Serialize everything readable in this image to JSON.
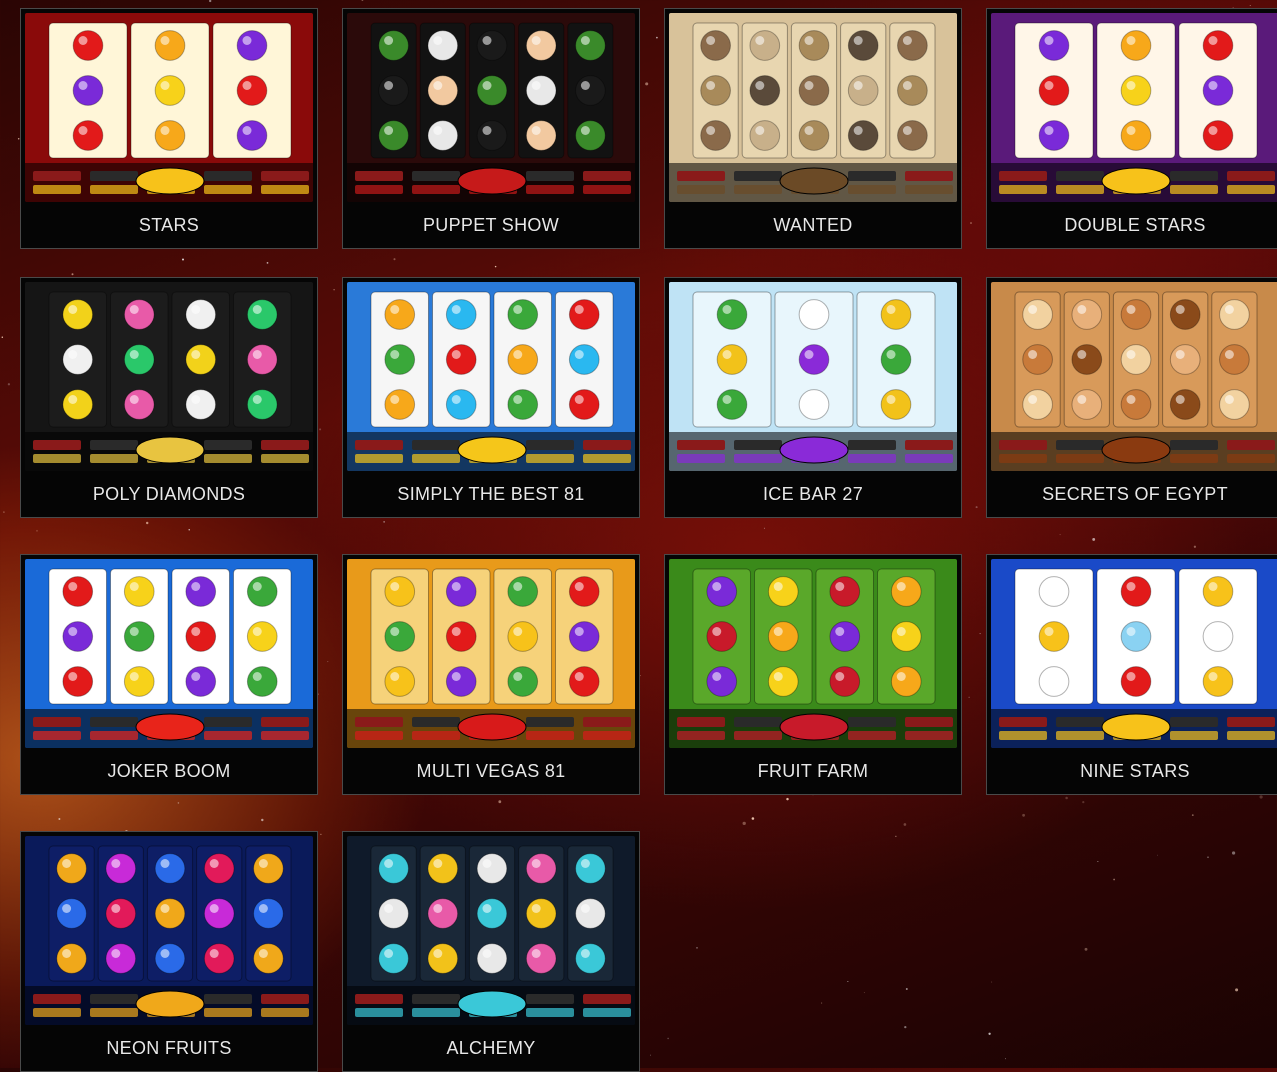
{
  "games": [
    {
      "title": "STARS",
      "theme": "fruit-classic",
      "bg": "#8a0a0a",
      "accent": "#f7c21a"
    },
    {
      "title": "PUPPET SHOW",
      "theme": "puppets",
      "bg": "#2b0a0a",
      "accent": "#c61a1a"
    },
    {
      "title": "WANTED",
      "theme": "western",
      "bg": "#d8c29a",
      "accent": "#6b4a26"
    },
    {
      "title": "DOUBLE STARS",
      "theme": "fruit-purple",
      "bg": "#5a1a7a",
      "accent": "#f7c21a"
    },
    {
      "title": "POLY DIAMONDS",
      "theme": "diamonds",
      "bg": "#151515",
      "accent": "#e8c440"
    },
    {
      "title": "SIMPLY THE BEST 81",
      "theme": "fruit-blue",
      "bg": "#2a7ad8",
      "accent": "#f5c61a"
    },
    {
      "title": "ICE BAR 27",
      "theme": "ice",
      "bg": "#bfe3f5",
      "accent": "#8a2ad8"
    },
    {
      "title": "SECRETS OF EGYPT",
      "theme": "egypt",
      "bg": "#c88a4a",
      "accent": "#8a3a10"
    },
    {
      "title": "JOKER BOOM",
      "theme": "joker",
      "bg": "#1a6ad8",
      "accent": "#e8241a"
    },
    {
      "title": "MULTI VEGAS 81",
      "theme": "vegas",
      "bg": "#e89a1a",
      "accent": "#d81a1a"
    },
    {
      "title": "FRUIT FARM",
      "theme": "farm",
      "bg": "#3a8a1a",
      "accent": "#c81a2a"
    },
    {
      "title": "NINE STARS",
      "theme": "nine",
      "bg": "#1a4ac8",
      "accent": "#f7c21a"
    },
    {
      "title": "NEON FRUITS",
      "theme": "neon",
      "bg": "#0a1a5a",
      "accent": "#f0a81a"
    },
    {
      "title": "ALCHEMY",
      "theme": "alchemy",
      "bg": "#0f1a2a",
      "accent": "#3ac8d8"
    }
  ]
}
